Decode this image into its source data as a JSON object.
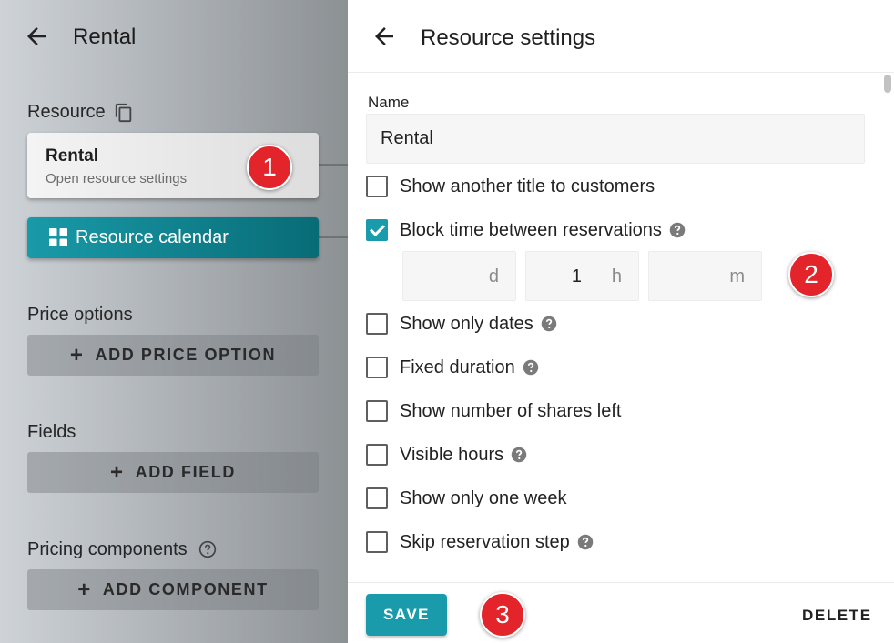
{
  "left_panel": {
    "title": "Rental",
    "resource_label": "Resource",
    "resource_card": {
      "title": "Rental",
      "subtitle": "Open resource settings"
    },
    "calendar_button": "Resource calendar",
    "price_options_label": "Price options",
    "add_price_option": "ADD PRICE OPTION",
    "fields_label": "Fields",
    "add_field": "ADD FIELD",
    "pricing_components_label": "Pricing components",
    "add_component": "ADD COMPONENT"
  },
  "settings": {
    "title": "Resource settings",
    "name_label": "Name",
    "name_value": "Rental",
    "options": [
      {
        "label": "Show another title to customers",
        "checked": false,
        "help": false
      },
      {
        "label": "Block time between reservations",
        "checked": true,
        "help": true
      },
      {
        "label": "Show only dates",
        "checked": false,
        "help": true
      },
      {
        "label": "Fixed duration",
        "checked": false,
        "help": true
      },
      {
        "label": "Show number of shares left",
        "checked": false,
        "help": false
      },
      {
        "label": "Visible hours",
        "checked": false,
        "help": true
      },
      {
        "label": "Show only one week",
        "checked": false,
        "help": false
      },
      {
        "label": "Skip reservation step",
        "checked": false,
        "help": true
      }
    ],
    "block_time": {
      "days": {
        "value": "",
        "unit": "d"
      },
      "hours": {
        "value": "1",
        "unit": "h"
      },
      "minutes": {
        "value": "",
        "unit": "m"
      }
    },
    "save_label": "SAVE",
    "delete_label": "DELETE"
  },
  "badges": [
    "1",
    "2",
    "3"
  ],
  "colors": {
    "accent": "#1a9bab",
    "badge": "#e3242b"
  },
  "icons": [
    "back-arrow-icon",
    "copy-icon",
    "grid-icon",
    "plus-icon",
    "help-icon",
    "check-icon"
  ]
}
